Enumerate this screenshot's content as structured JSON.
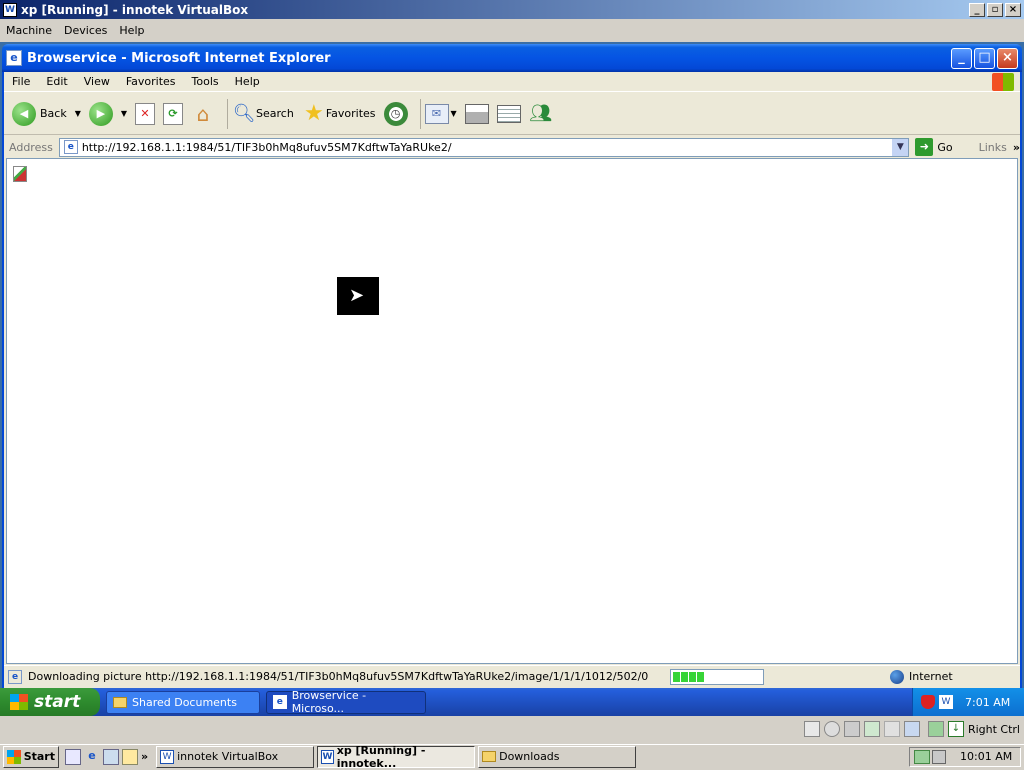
{
  "host": {
    "title": "xp [Running] - innotek VirtualBox",
    "menu": [
      "Machine",
      "Devices",
      "Help"
    ],
    "right_ctrl": "Right Ctrl"
  },
  "ie": {
    "title": "Browservice - Microsoft Internet Explorer",
    "menu": [
      "File",
      "Edit",
      "View",
      "Favorites",
      "Tools",
      "Help"
    ],
    "toolbar": {
      "back": "Back",
      "search": "Search",
      "favorites": "Favorites"
    },
    "address": {
      "label": "Address",
      "url": "http://192.168.1.1:1984/51/TIF3b0hMq8ufuv5SM7KdftwTaYaRUke2/",
      "go": "Go",
      "links": "Links"
    },
    "status": {
      "text": "Downloading picture http://192.168.1.1:1984/51/TIF3b0hMq8ufuv5SM7KdftwTaYaRUke2/image/1/1/1/1012/502/0/...",
      "progress_segments": 4,
      "zone": "Internet"
    }
  },
  "xp_taskbar": {
    "start": "start",
    "tasks": [
      "Shared Documents",
      "Browservice - Microso..."
    ],
    "clock": "7:01 AM"
  },
  "host_taskbar": {
    "start": "Start",
    "tasks": [
      "innotek VirtualBox",
      "xp [Running] - innotek...",
      "Downloads"
    ],
    "clock": "10:01 AM"
  }
}
